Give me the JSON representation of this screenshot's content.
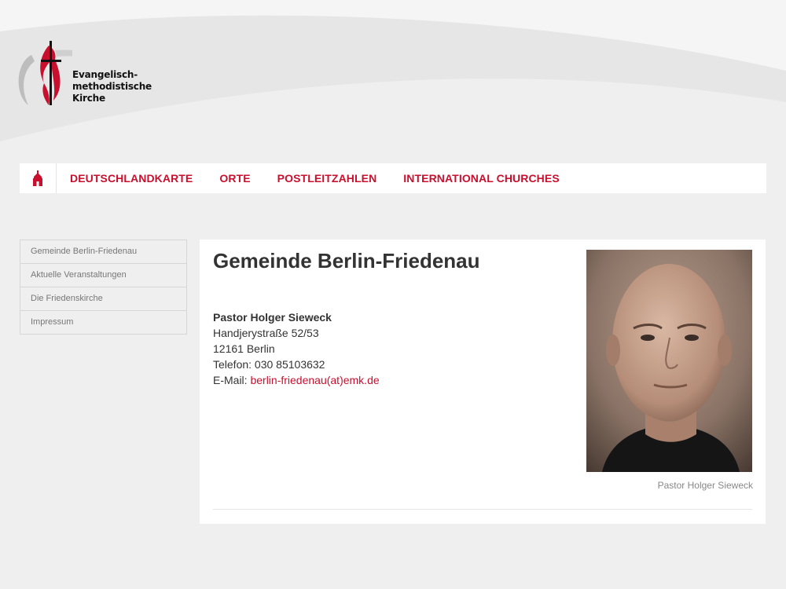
{
  "logo": {
    "text": "Evangelisch-\nmethodistische\nKirche",
    "accent": "#c8102e"
  },
  "nav": {
    "home_icon": "church-icon",
    "items": [
      "DEUTSCHLANDKARTE",
      "ORTE",
      "POSTLEITZAHLEN",
      "INTERNATIONAL CHURCHES"
    ]
  },
  "sidebar": {
    "items": [
      "Gemeinde Berlin-Friedenau",
      "Aktuelle Veranstaltungen",
      "Die Friedenskirche",
      "Impressum"
    ]
  },
  "main": {
    "title": "Gemeinde Berlin-Friedenau",
    "contact": {
      "name": "Pastor Holger Sieweck",
      "street": "Handjerystraße 52/53",
      "city": "12161 Berlin",
      "phone": "Telefon: 030 85103632",
      "email_label": "E-Mail: ",
      "email": "berlin-friedenau(at)emk.de"
    },
    "photo_caption": "Pastor Holger Sieweck"
  },
  "colors": {
    "accent": "#c8102e",
    "background": "#efefef"
  }
}
